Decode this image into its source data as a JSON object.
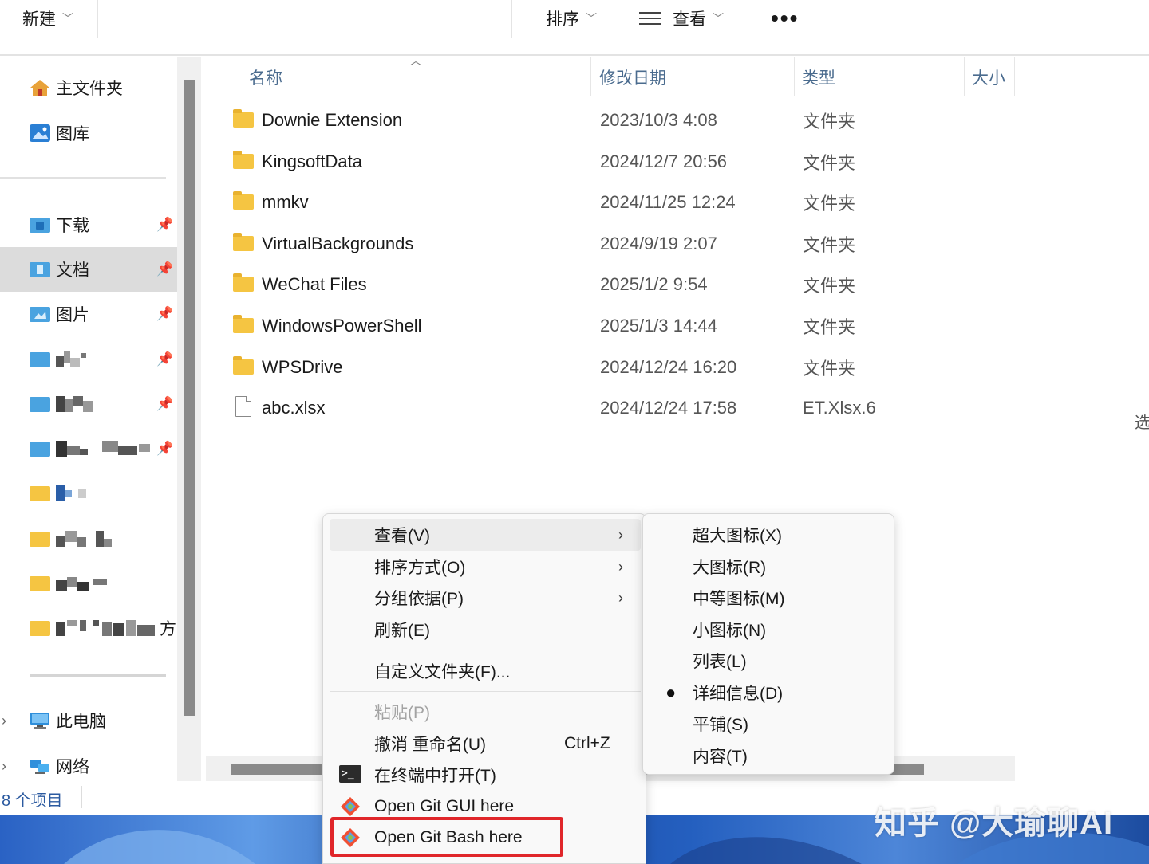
{
  "toolbar": {
    "new_label": "新建",
    "sort_label": "排序",
    "view_label": "查看",
    "more_label": "•••"
  },
  "sidebar": {
    "home_label": "主文件夹",
    "gallery_label": "图库",
    "downloads_label": "下载",
    "documents_label": "文档",
    "pictures_label": "图片",
    "partial_label": "方",
    "this_pc_label": "此电脑",
    "network_label": "网络"
  },
  "columns": {
    "name": "名称",
    "modified": "修改日期",
    "type": "类型",
    "size": "大小"
  },
  "files": [
    {
      "name": "Downie Extension",
      "date": "2023/10/3 4:08",
      "type": "文件夹",
      "kind": "folder"
    },
    {
      "name": "KingsoftData",
      "date": "2024/12/7 20:56",
      "type": "文件夹",
      "kind": "folder"
    },
    {
      "name": "mmkv",
      "date": "2024/11/25 12:24",
      "type": "文件夹",
      "kind": "folder"
    },
    {
      "name": "VirtualBackgrounds",
      "date": "2024/9/19 2:07",
      "type": "文件夹",
      "kind": "folder"
    },
    {
      "name": "WeChat Files",
      "date": "2025/1/2 9:54",
      "type": "文件夹",
      "kind": "folder"
    },
    {
      "name": "WindowsPowerShell",
      "date": "2025/1/3 14:44",
      "type": "文件夹",
      "kind": "folder"
    },
    {
      "name": "WPSDrive",
      "date": "2024/12/24 16:20",
      "type": "文件夹",
      "kind": "folder"
    },
    {
      "name": "abc.xlsx",
      "date": "2024/12/24 17:58",
      "type": "ET.Xlsx.6",
      "kind": "file"
    }
  ],
  "right_cut_text": "选",
  "status": {
    "count": "8 个项目"
  },
  "context_menu": {
    "view": "查看(V)",
    "sort_by": "排序方式(O)",
    "group_by": "分组依据(P)",
    "refresh": "刷新(E)",
    "customize": "自定义文件夹(F)...",
    "paste": "粘贴(P)",
    "undo": "撤消 重命名(U)",
    "undo_shortcut": "Ctrl+Z",
    "open_terminal": "在终端中打开(T)",
    "git_gui": "Open Git GUI here",
    "git_bash": "Open Git Bash here"
  },
  "view_submenu": {
    "extra_large": "超大图标(X)",
    "large": "大图标(R)",
    "medium": "中等图标(M)",
    "small": "小图标(N)",
    "list": "列表(L)",
    "details": "详细信息(D)",
    "tiles": "平铺(S)",
    "content": "内容(T)",
    "selected_bullet": "●"
  },
  "watermark": "知乎 @大瑜聊AI",
  "colors": {
    "accent": "#2b5aa0",
    "folder": "#f5c542",
    "highlight": "#e0262a",
    "selected_bg": "#dcdcdc"
  }
}
